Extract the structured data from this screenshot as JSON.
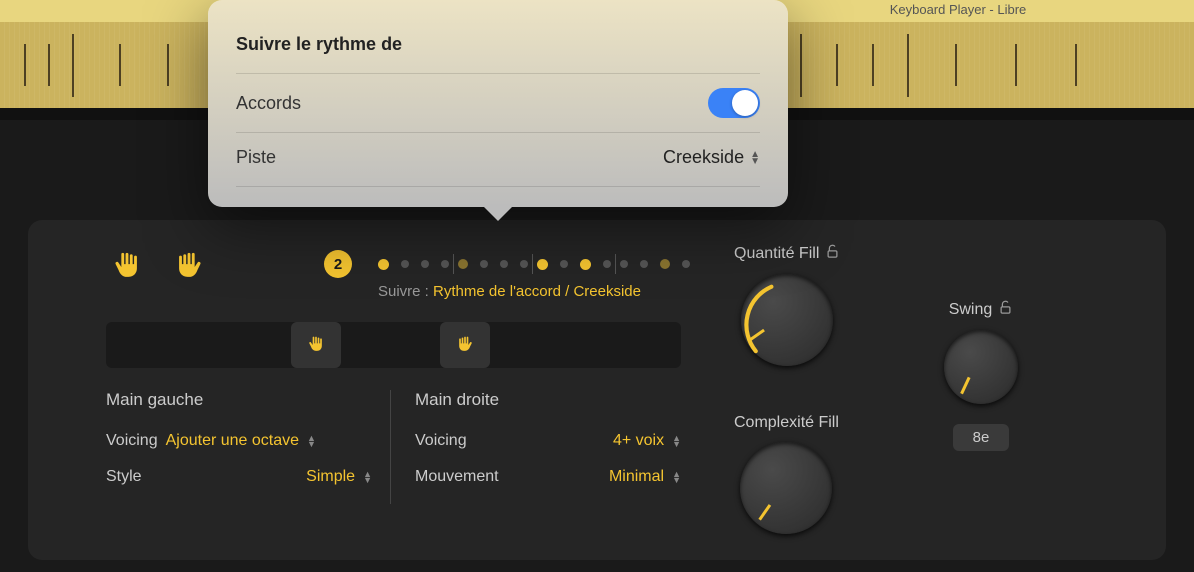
{
  "track": {
    "title": "Keyboard Player - Libre"
  },
  "popover": {
    "heading": "Suivre le rythme de",
    "accords_label": "Accords",
    "accords_on": true,
    "piste_label": "Piste",
    "piste_value": "Creekside"
  },
  "pattern": {
    "badge": "2",
    "suivre_prefix": "Suivre : ",
    "suivre_value": "Rythme de l'accord / Creekside"
  },
  "left_hand": {
    "title": "Main gauche",
    "voicing_label": "Voicing",
    "voicing_value": "Ajouter une octave",
    "style_label": "Style",
    "style_value": "Simple"
  },
  "right_hand": {
    "title": "Main droite",
    "voicing_label": "Voicing",
    "voicing_value": "4+ voix",
    "movement_label": "Mouvement",
    "movement_value": "Minimal"
  },
  "knobs": {
    "fill_amount": "Quantité Fill",
    "fill_complexity": "Complexité Fill",
    "swing": "Swing",
    "swing_mode": "8e"
  }
}
